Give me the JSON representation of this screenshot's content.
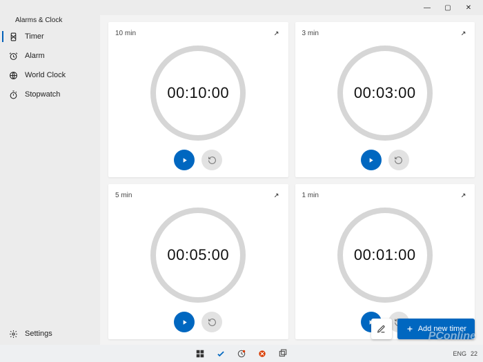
{
  "app": {
    "title": "Alarms & Clock"
  },
  "window_controls": {
    "minimize": "—",
    "maximize": "▢",
    "close": "✕"
  },
  "nav": {
    "items": [
      {
        "label": "Timer",
        "icon": "timer"
      },
      {
        "label": "Alarm",
        "icon": "alarm"
      },
      {
        "label": "World Clock",
        "icon": "world"
      },
      {
        "label": "Stopwatch",
        "icon": "stopwatch"
      }
    ],
    "settings_label": "Settings"
  },
  "timers": [
    {
      "name": "10 min",
      "time": "00:10:00"
    },
    {
      "name": "3 min",
      "time": "00:03:00"
    },
    {
      "name": "5 min",
      "time": "00:05:00"
    },
    {
      "name": "1 min",
      "time": "00:01:00"
    }
  ],
  "actions": {
    "add_label": "Add new timer"
  },
  "taskbar": {
    "lang": "ENG",
    "time_fragment": "22"
  },
  "watermark": "PConline"
}
